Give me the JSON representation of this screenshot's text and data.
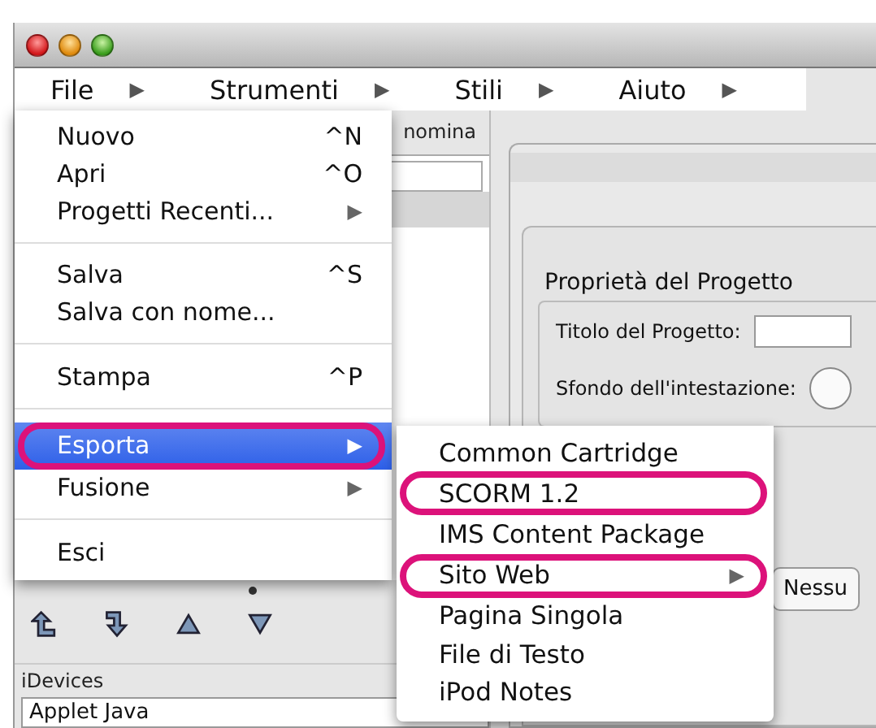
{
  "menu_bar": [
    {
      "label": "File",
      "arrow": "▶"
    },
    {
      "label": "Strumenti",
      "arrow": "▶"
    },
    {
      "label": "Stili",
      "arrow": "▶"
    },
    {
      "label": "Aiuto",
      "arrow": "▶"
    }
  ],
  "toolbar": {
    "label": "nomina"
  },
  "file_menu": {
    "items": [
      {
        "kind": "item",
        "label": "Nuovo",
        "shortcut": "^N",
        "selected": false,
        "highlighted": false
      },
      {
        "kind": "item",
        "label": "Apri",
        "shortcut": "^O",
        "selected": false,
        "highlighted": false
      },
      {
        "kind": "item",
        "label": "Progetti Recenti...",
        "arrow": "▶",
        "selected": false,
        "highlighted": false
      },
      {
        "kind": "separator"
      },
      {
        "kind": "item",
        "label": "Salva",
        "shortcut": "^S",
        "selected": false,
        "highlighted": false
      },
      {
        "kind": "item",
        "label": "Salva con nome...",
        "selected": false,
        "highlighted": false
      },
      {
        "kind": "separator"
      },
      {
        "kind": "item",
        "label": "Stampa",
        "shortcut": "^P",
        "selected": false,
        "highlighted": false
      },
      {
        "kind": "separator"
      },
      {
        "kind": "item",
        "label": "Esporta",
        "arrow": "▶",
        "selected": true,
        "highlighted": true
      },
      {
        "kind": "item",
        "label": "Fusione",
        "arrow": "▶",
        "selected": false,
        "highlighted": false
      },
      {
        "kind": "separator"
      },
      {
        "kind": "item",
        "label": "Esci",
        "selected": false,
        "highlighted": false
      }
    ]
  },
  "export_submenu": {
    "items": [
      {
        "label": "Common Cartridge",
        "selected": false,
        "highlighted": false
      },
      {
        "label": "SCORM 1.2",
        "selected": false,
        "highlighted": true
      },
      {
        "label": "IMS Content Package",
        "selected": false,
        "highlighted": false
      },
      {
        "label": "Sito Web",
        "arrow": "▶",
        "selected": false,
        "highlighted": true
      },
      {
        "label": "Pagina Singola",
        "selected": false,
        "highlighted": false
      },
      {
        "label": "File di Testo",
        "selected": false,
        "highlighted": false
      },
      {
        "label": "iPod Notes",
        "selected": false,
        "highlighted": false
      }
    ]
  },
  "idevices": {
    "title": "iDevices",
    "items": [
      "Applet Java"
    ]
  },
  "properties": {
    "title": "Proprietà del Progetto",
    "fields": [
      {
        "kind": "text",
        "label": "Titolo del Progetto:"
      },
      {
        "kind": "round-button",
        "label": "Sfondo dell'intestazione:"
      },
      {
        "kind": "select",
        "value": "Nessu"
      }
    ]
  }
}
